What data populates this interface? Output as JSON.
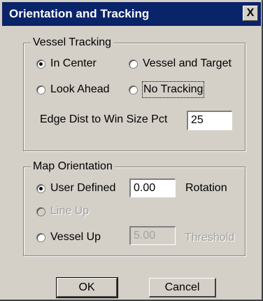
{
  "window": {
    "title": "Orientation and Tracking",
    "close_glyph": "X"
  },
  "vessel_tracking": {
    "title": "Vessel Tracking",
    "options": [
      {
        "label": "In Center",
        "checked": true
      },
      {
        "label": "Vessel and Target",
        "checked": false
      },
      {
        "label": "Look Ahead",
        "checked": false
      },
      {
        "label": "No Tracking",
        "checked": false
      }
    ],
    "edge_label": "Edge Dist to Win Size Pct",
    "edge_value": "25"
  },
  "map_orientation": {
    "title": "Map Orientation",
    "user_defined": {
      "label": "User Defined",
      "checked": true,
      "value": "0.00",
      "suffix": "Rotation"
    },
    "line_up": {
      "label": "Line Up",
      "enabled": false
    },
    "vessel_up": {
      "label": "Vessel Up",
      "checked": false,
      "value": "5.00",
      "suffix": "Threshold"
    }
  },
  "buttons": {
    "ok": "OK",
    "cancel": "Cancel"
  },
  "icons": {
    "close": "close-icon"
  }
}
